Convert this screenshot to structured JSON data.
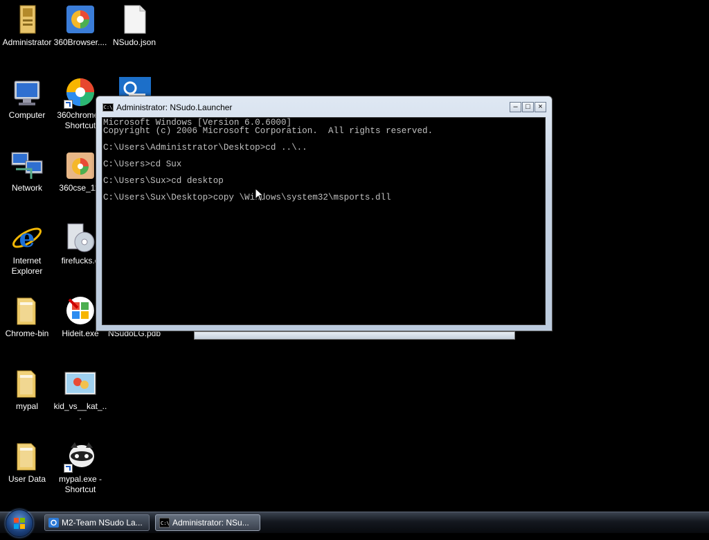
{
  "desktop": {
    "icons": [
      {
        "label": "Administrator",
        "icon": "user-folder-icon"
      },
      {
        "label": "360Browser....",
        "icon": "360-browser-icon"
      },
      {
        "label": "NSudo.json",
        "icon": "file-icon"
      },
      {
        "label": "Computer",
        "icon": "computer-icon"
      },
      {
        "label": "360chrome - Shortcut",
        "icon": "360chrome-icon"
      },
      {
        "label": "",
        "icon": "settings-app-icon"
      },
      {
        "label": "Network",
        "icon": "network-icon"
      },
      {
        "label": "360cse_11.",
        "icon": "installer-icon"
      },
      {
        "label": "Internet Explorer",
        "icon": "internet-explorer-icon"
      },
      {
        "label": "firefucks.e",
        "icon": "disc-installer-icon"
      },
      {
        "label": "Chrome-bin",
        "icon": "folder-icon"
      },
      {
        "label": "Hideit.exe",
        "icon": "hideit-icon"
      },
      {
        "label": "NSudoLG.pdb",
        "icon": "file-icon"
      },
      {
        "label": "mypal",
        "icon": "folder-icon"
      },
      {
        "label": "kid_vs__kat_...",
        "icon": "image-thumbnail-icon"
      },
      {
        "label": "User Data",
        "icon": "folder-icon"
      },
      {
        "label": "mypal.exe - Shortcut",
        "icon": "raccoon-app-icon"
      }
    ]
  },
  "console_window": {
    "title": "Administrator: NSudo.Launcher",
    "icon_text": "C:\\",
    "buttons": {
      "minimize": "–",
      "maximize": "□",
      "close": "×"
    },
    "lines": [
      "Microsoft Windows [Version 6.0.6000]",
      "Copyright (c) 2006 Microsoft Corporation.  All rights reserved.",
      "",
      "C:\\Users\\Administrator\\Desktop>cd ..\\..",
      "",
      "C:\\Users>cd Sux",
      "",
      "C:\\Users\\Sux>cd desktop",
      "",
      "C:\\Users\\Sux\\Desktop>copy \\Windows\\system32\\msports.dll"
    ]
  },
  "taskbar": {
    "start_icon": "windows-start-orb-icon",
    "tasks": [
      {
        "label": "M2-Team NSudo La...",
        "icon": "nsudo-app-icon",
        "active": false
      },
      {
        "label": "Administrator: NSu...",
        "icon": "cmd-icon",
        "active": true
      }
    ]
  },
  "colors": {
    "desktop_bg": "#000000",
    "console_text": "#c0c0c0"
  }
}
